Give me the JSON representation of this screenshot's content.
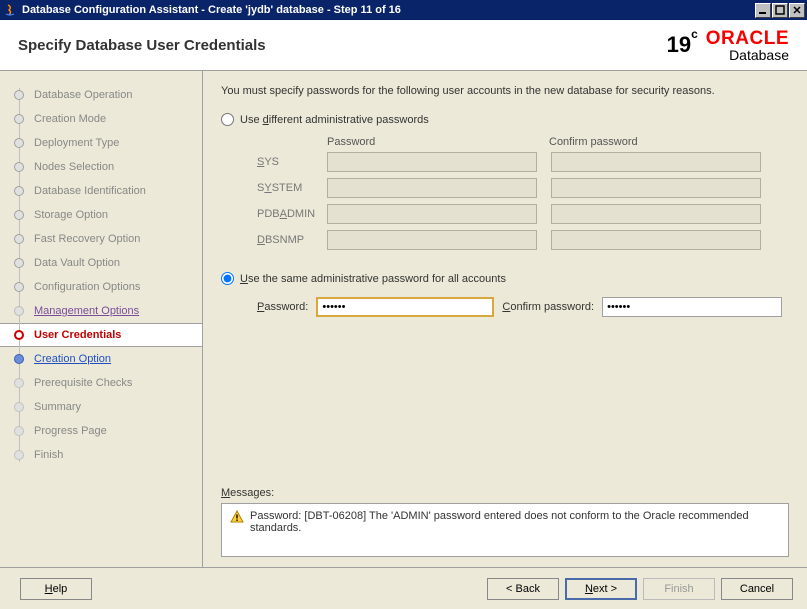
{
  "window": {
    "title": "Database Configuration Assistant - Create 'jydb' database - Step 11 of 16"
  },
  "header": {
    "title": "Specify Database User Credentials",
    "version": "19",
    "version_sup": "c",
    "brand": "ORACLE",
    "sub": "Database"
  },
  "sidebar": {
    "steps": [
      {
        "label": "Database Operation"
      },
      {
        "label": "Creation Mode"
      },
      {
        "label": "Deployment Type"
      },
      {
        "label": "Nodes Selection"
      },
      {
        "label": "Database Identification"
      },
      {
        "label": "Storage Option"
      },
      {
        "label": "Fast Recovery Option"
      },
      {
        "label": "Data Vault Option"
      },
      {
        "label": "Configuration Options"
      },
      {
        "label": "Management Options"
      },
      {
        "label": "User Credentials"
      },
      {
        "label": "Creation Option"
      },
      {
        "label": "Prerequisite Checks"
      },
      {
        "label": "Summary"
      },
      {
        "label": "Progress Page"
      },
      {
        "label": "Finish"
      }
    ]
  },
  "main": {
    "intro": "You must specify passwords for the following user accounts in the new database for security reasons.",
    "radio1": "Use different administrative passwords",
    "radio2": "Use the same administrative password for all accounts",
    "col_password": "Password",
    "col_confirm": "Confirm password",
    "accounts": [
      "SYS",
      "SYSTEM",
      "PDBADMIN",
      "DBSNMP"
    ],
    "same_password_label": "Password:",
    "same_confirm_label": "Confirm password:",
    "password_value": "••••••",
    "confirm_value": "••••••",
    "messages_label": "Messages:",
    "message_text": "Password: [DBT-06208] The 'ADMIN' password entered does not conform to the Oracle recommended standards."
  },
  "footer": {
    "help": "Help",
    "back": "< Back",
    "next": "Next >",
    "finish": "Finish",
    "cancel": "Cancel"
  }
}
